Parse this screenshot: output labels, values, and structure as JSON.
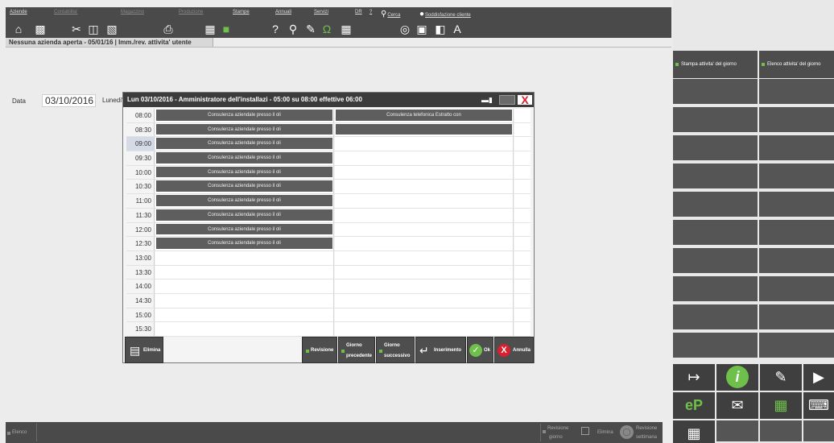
{
  "menu": {
    "items": [
      {
        "label": "Aziende",
        "dim": false
      },
      {
        "label": "Contabilita'",
        "dim": true
      },
      {
        "label": "Magazzino",
        "dim": true
      },
      {
        "label": "Produzione",
        "dim": true
      },
      {
        "label": "Stampe",
        "dim": false
      },
      {
        "label": "Annuali",
        "dim": false
      },
      {
        "label": "Servizi",
        "dim": false
      },
      {
        "label": "DR",
        "dim": false
      },
      {
        "label": "?",
        "dim": false
      },
      {
        "label": "Cerca",
        "dim": false
      },
      {
        "label": "Soddisfazione cliente",
        "dim": false
      }
    ]
  },
  "toolbar": {
    "icons": [
      "home-icon",
      "import-icon",
      "scissors-icon",
      "copy-icon",
      "printer-tray-icon",
      "printer-icon",
      "box-icon",
      "green-archive-icon",
      "help-icon",
      "magnify-user-icon",
      "eraser-icon",
      "omega-icon",
      "calculator-icon",
      "radio-icon",
      "screen-icon",
      "window-icon",
      "font-icon"
    ]
  },
  "tab": {
    "label": "Nessuna azienda aperta - 05/01/16 | Imm./rev. attivita' utente"
  },
  "date": {
    "label": "Data",
    "value": "03/10/2016",
    "day": "Lunedi'"
  },
  "dialog": {
    "title": "Lun 03/10/2016 - Amministratore dell'installazi - 05:00 su 08:00 effettive 06:00",
    "rows": [
      {
        "time": "08:00",
        "selected": false,
        "a1": "Consulenza aziendale presso il oli",
        "a2": "Consulenza telefonica Estratto con"
      },
      {
        "time": "08:30",
        "selected": false,
        "a1": "Consulenza aziendale presso il oli",
        "a2": ""
      },
      {
        "time": "09:00",
        "selected": true,
        "a1": "Consulenza aziendale presso il oli",
        "a2": null
      },
      {
        "time": "09:30",
        "selected": false,
        "a1": "Consulenza aziendale presso il oli",
        "a2": null
      },
      {
        "time": "10:00",
        "selected": false,
        "a1": "Consulenza aziendale presso il oli",
        "a2": null
      },
      {
        "time": "10:30",
        "selected": false,
        "a1": "Consulenza aziendale presso il oli",
        "a2": null
      },
      {
        "time": "11:00",
        "selected": false,
        "a1": "Consulenza aziendale presso il oli",
        "a2": null
      },
      {
        "time": "11:30",
        "selected": false,
        "a1": "Consulenza aziendale presso il oli",
        "a2": null
      },
      {
        "time": "12:00",
        "selected": false,
        "a1": "Consulenza aziendale presso il oli",
        "a2": null
      },
      {
        "time": "12:30",
        "selected": false,
        "a1": "Consulenza aziendale presso il oli",
        "a2": null
      },
      {
        "time": "13:00",
        "selected": false,
        "a1": null,
        "a2": null
      },
      {
        "time": "13:30",
        "selected": false,
        "a1": null,
        "a2": null
      },
      {
        "time": "14:00",
        "selected": false,
        "a1": null,
        "a2": null
      },
      {
        "time": "14:30",
        "selected": false,
        "a1": null,
        "a2": null
      },
      {
        "time": "15:00",
        "selected": false,
        "a1": null,
        "a2": null
      },
      {
        "time": "15:30",
        "selected": false,
        "a1": null,
        "a2": null
      }
    ],
    "buttons": {
      "elimina": "Elimina",
      "revisione": "Revisione",
      "giorno_prec_1": "Giorno",
      "giorno_prec_2": "precedente",
      "giorno_succ_1": "Giorno",
      "giorno_succ_2": "successivo",
      "inserimento": "Inserimento",
      "ok": "Ok",
      "annulla": "Annulla"
    }
  },
  "right_panel": {
    "header_left": "Stampa attivita' del giorno",
    "header_right": "Elenco attivita' del giorno",
    "accent": "#6ec04a"
  },
  "bottom_bar": {
    "elenco": "Elenco",
    "revisione_giorno_1": "Revisione",
    "revisione_giorno_2": "giorno",
    "elimina": "Elimina",
    "revisione_settimana_1": "Revisione",
    "revisione_settimana_2": "settimana"
  }
}
